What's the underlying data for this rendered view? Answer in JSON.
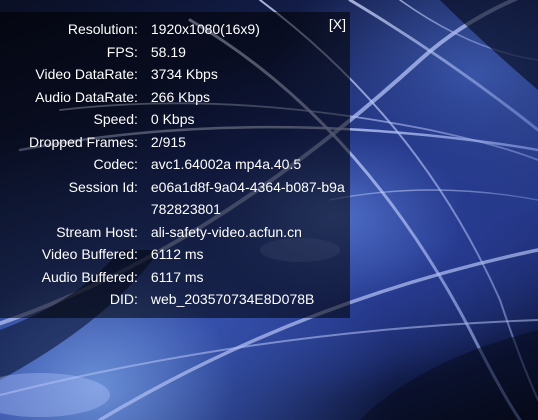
{
  "overlay": {
    "close_label": "[X]",
    "rows": [
      {
        "label": "Resolution:",
        "value": "1920x1080(16x9)"
      },
      {
        "label": "FPS:",
        "value": "58.19"
      },
      {
        "label": "Video DataRate:",
        "value": "3734 Kbps"
      },
      {
        "label": "Audio DataRate:",
        "value": "266 Kbps"
      },
      {
        "label": "Speed:",
        "value": "0 Kbps"
      },
      {
        "label": "Dropped Frames:",
        "value": "2/915"
      },
      {
        "label": "Codec:",
        "value": "avc1.64002a mp4a.40.5"
      },
      {
        "label": "Session Id:",
        "value": "e06a1d8f-9a04-4364-b087-b9a782823801"
      },
      {
        "label": "Stream Host:",
        "value": "ali-safety-video.acfun.cn"
      },
      {
        "label": "Video Buffered:",
        "value": "6112 ms"
      },
      {
        "label": "Audio Buffered:",
        "value": "6117 ms"
      },
      {
        "label": "DID:",
        "value": "web_203570734E8D078B"
      }
    ]
  },
  "colors": {
    "text": "#ffffff",
    "panel_background": "rgba(0,0,0,0.55)"
  }
}
